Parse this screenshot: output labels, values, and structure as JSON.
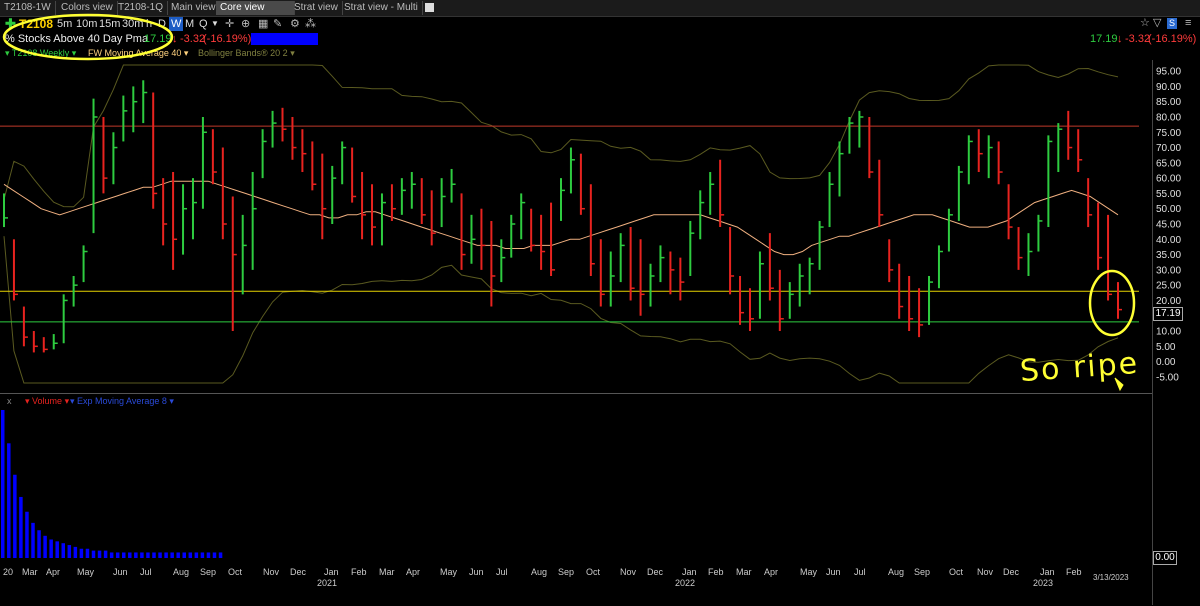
{
  "tabs": [
    {
      "label": "T2108-1W",
      "active": false
    },
    {
      "label": "Colors view",
      "active": false
    },
    {
      "label": "T2108-1Q",
      "active": false
    },
    {
      "label": "Main view",
      "active": false
    },
    {
      "label": "Core view",
      "active": true
    },
    {
      "label": "Strat view",
      "active": false
    },
    {
      "label": "Strat view - Multi",
      "active": false
    }
  ],
  "toolbar": {
    "symbol": "T2108",
    "intervals": [
      "5m",
      "10m",
      "15m",
      "30m",
      "h",
      "D",
      "W",
      "M",
      "Q"
    ],
    "selected_interval": "W"
  },
  "info": {
    "name": "% Stocks Above 40 Day Pma",
    "last": "17.19",
    "change": "-3.32",
    "change_pct": "(-16.19%)"
  },
  "legend": {
    "series": "T2108 Weekly",
    "ma": "FW Moving Average 40",
    "bb": "Bollinger Bands® 20 2"
  },
  "volume_legend": {
    "volume": "Volume",
    "ma": "Exp Moving Average 8"
  },
  "annotation": "So ripe",
  "chart_data": {
    "type": "bar",
    "ylim": [
      -7,
      97
    ],
    "yticks": [
      "95.00",
      "90.00",
      "85.00",
      "80.00",
      "75.00",
      "70.00",
      "65.00",
      "60.00",
      "55.00",
      "50.00",
      "45.00",
      "40.00",
      "35.00",
      "30.00",
      "25.00",
      "20.00",
      "15.00",
      "10.00",
      "5.00",
      "0.00",
      "-5.00"
    ],
    "last_label": "17.19",
    "volume_label": "0.00",
    "date_label": "3/13/2023",
    "x_labels": [
      "20",
      "Mar",
      "Apr",
      "May",
      "Jun",
      "Jul",
      "Aug",
      "Sep",
      "Oct",
      "Nov",
      "Dec",
      "Jan",
      "Feb",
      "Mar",
      "Apr",
      "May",
      "Jun",
      "Jul",
      "Aug",
      "Sep",
      "Oct",
      "Nov",
      "Dec",
      "Jan",
      "Feb",
      "Mar",
      "Apr",
      "May",
      "Jun",
      "Jul",
      "Aug",
      "Sep",
      "Oct",
      "Nov",
      "Dec",
      "Jan",
      "Feb"
    ],
    "year_labels": [
      "2021",
      "2022",
      "2023"
    ],
    "hlines": [
      {
        "value": 77,
        "color": "#c0392b"
      },
      {
        "value": 23,
        "color": "#e6d200"
      },
      {
        "value": 13,
        "color": "#2ecc40"
      }
    ],
    "colors": {
      "up": "#2ecc40",
      "down": "#e8231f",
      "ma": "#f0b080",
      "bb": "#5a5a20",
      "volume": "#0000ff"
    },
    "bars": [
      {
        "h": 55,
        "l": 44,
        "c": 47
      },
      {
        "h": 40,
        "l": 20,
        "c": 22
      },
      {
        "h": 18,
        "l": 5,
        "c": 8
      },
      {
        "h": 10,
        "l": 3,
        "c": 5
      },
      {
        "h": 8,
        "l": 3,
        "c": 4
      },
      {
        "h": 9,
        "l": 4,
        "c": 6
      },
      {
        "h": 22,
        "l": 6,
        "c": 20
      },
      {
        "h": 28,
        "l": 18,
        "c": 25
      },
      {
        "h": 38,
        "l": 26,
        "c": 36
      },
      {
        "h": 86,
        "l": 42,
        "c": 80
      },
      {
        "h": 80,
        "l": 55,
        "c": 60
      },
      {
        "h": 75,
        "l": 58,
        "c": 70
      },
      {
        "h": 87,
        "l": 72,
        "c": 82
      },
      {
        "h": 90,
        "l": 75,
        "c": 85
      },
      {
        "h": 92,
        "l": 78,
        "c": 88
      },
      {
        "h": 88,
        "l": 50,
        "c": 55
      },
      {
        "h": 60,
        "l": 38,
        "c": 45
      },
      {
        "h": 62,
        "l": 30,
        "c": 40
      },
      {
        "h": 58,
        "l": 35,
        "c": 50
      },
      {
        "h": 60,
        "l": 40,
        "c": 52
      },
      {
        "h": 80,
        "l": 50,
        "c": 75
      },
      {
        "h": 76,
        "l": 58,
        "c": 62
      },
      {
        "h": 70,
        "l": 40,
        "c": 45
      },
      {
        "h": 54,
        "l": 10,
        "c": 35
      },
      {
        "h": 48,
        "l": 22,
        "c": 38
      },
      {
        "h": 62,
        "l": 30,
        "c": 50
      },
      {
        "h": 76,
        "l": 60,
        "c": 72
      },
      {
        "h": 82,
        "l": 70,
        "c": 78
      },
      {
        "h": 83,
        "l": 72,
        "c": 76
      },
      {
        "h": 80,
        "l": 66,
        "c": 70
      },
      {
        "h": 76,
        "l": 62,
        "c": 68
      },
      {
        "h": 72,
        "l": 56,
        "c": 58
      },
      {
        "h": 68,
        "l": 40,
        "c": 50
      },
      {
        "h": 64,
        "l": 45,
        "c": 60
      },
      {
        "h": 72,
        "l": 58,
        "c": 70
      },
      {
        "h": 70,
        "l": 52,
        "c": 54
      },
      {
        "h": 62,
        "l": 40,
        "c": 48
      },
      {
        "h": 58,
        "l": 38,
        "c": 44
      },
      {
        "h": 55,
        "l": 38,
        "c": 52
      },
      {
        "h": 58,
        "l": 46,
        "c": 50
      },
      {
        "h": 60,
        "l": 48,
        "c": 56
      },
      {
        "h": 62,
        "l": 50,
        "c": 58
      },
      {
        "h": 60,
        "l": 45,
        "c": 48
      },
      {
        "h": 56,
        "l": 38,
        "c": 42
      },
      {
        "h": 60,
        "l": 44,
        "c": 54
      },
      {
        "h": 63,
        "l": 52,
        "c": 58
      },
      {
        "h": 55,
        "l": 30,
        "c": 35
      },
      {
        "h": 48,
        "l": 32,
        "c": 40
      },
      {
        "h": 50,
        "l": 30,
        "c": 38
      },
      {
        "h": 46,
        "l": 18,
        "c": 28
      },
      {
        "h": 40,
        "l": 26,
        "c": 34
      },
      {
        "h": 48,
        "l": 34,
        "c": 45
      },
      {
        "h": 55,
        "l": 40,
        "c": 52
      },
      {
        "h": 50,
        "l": 36,
        "c": 38
      },
      {
        "h": 48,
        "l": 30,
        "c": 36
      },
      {
        "h": 52,
        "l": 28,
        "c": 30
      },
      {
        "h": 60,
        "l": 46,
        "c": 56
      },
      {
        "h": 70,
        "l": 55,
        "c": 66
      },
      {
        "h": 68,
        "l": 48,
        "c": 50
      },
      {
        "h": 58,
        "l": 28,
        "c": 32
      },
      {
        "h": 40,
        "l": 18,
        "c": 22
      },
      {
        "h": 36,
        "l": 18,
        "c": 28
      },
      {
        "h": 42,
        "l": 26,
        "c": 38
      },
      {
        "h": 44,
        "l": 20,
        "c": 24
      },
      {
        "h": 40,
        "l": 15,
        "c": 22
      },
      {
        "h": 32,
        "l": 18,
        "c": 28
      },
      {
        "h": 38,
        "l": 26,
        "c": 34
      },
      {
        "h": 36,
        "l": 22,
        "c": 30
      },
      {
        "h": 34,
        "l": 20,
        "c": 26
      },
      {
        "h": 46,
        "l": 28,
        "c": 42
      },
      {
        "h": 56,
        "l": 40,
        "c": 52
      },
      {
        "h": 62,
        "l": 48,
        "c": 58
      },
      {
        "h": 66,
        "l": 44,
        "c": 48
      },
      {
        "h": 44,
        "l": 22,
        "c": 28
      },
      {
        "h": 28,
        "l": 12,
        "c": 16
      },
      {
        "h": 24,
        "l": 10,
        "c": 14
      },
      {
        "h": 36,
        "l": 14,
        "c": 32
      },
      {
        "h": 42,
        "l": 20,
        "c": 24
      },
      {
        "h": 30,
        "l": 10,
        "c": 14
      },
      {
        "h": 26,
        "l": 14,
        "c": 22
      },
      {
        "h": 32,
        "l": 18,
        "c": 28
      },
      {
        "h": 34,
        "l": 22,
        "c": 32
      },
      {
        "h": 46,
        "l": 30,
        "c": 44
      },
      {
        "h": 62,
        "l": 44,
        "c": 58
      },
      {
        "h": 72,
        "l": 54,
        "c": 68
      },
      {
        "h": 80,
        "l": 68,
        "c": 78
      },
      {
        "h": 82,
        "l": 70,
        "c": 80
      },
      {
        "h": 80,
        "l": 60,
        "c": 62
      },
      {
        "h": 66,
        "l": 44,
        "c": 48
      },
      {
        "h": 40,
        "l": 26,
        "c": 30
      },
      {
        "h": 32,
        "l": 14,
        "c": 18
      },
      {
        "h": 28,
        "l": 10,
        "c": 14
      },
      {
        "h": 24,
        "l": 8,
        "c": 12
      },
      {
        "h": 28,
        "l": 12,
        "c": 26
      },
      {
        "h": 38,
        "l": 24,
        "c": 36
      },
      {
        "h": 50,
        "l": 36,
        "c": 48
      },
      {
        "h": 64,
        "l": 46,
        "c": 62
      },
      {
        "h": 74,
        "l": 58,
        "c": 72
      },
      {
        "h": 76,
        "l": 62,
        "c": 68
      },
      {
        "h": 74,
        "l": 60,
        "c": 70
      },
      {
        "h": 72,
        "l": 58,
        "c": 62
      },
      {
        "h": 58,
        "l": 40,
        "c": 44
      },
      {
        "h": 44,
        "l": 30,
        "c": 34
      },
      {
        "h": 42,
        "l": 28,
        "c": 36
      },
      {
        "h": 48,
        "l": 36,
        "c": 46
      },
      {
        "h": 74,
        "l": 44,
        "c": 72
      },
      {
        "h": 78,
        "l": 62,
        "c": 76
      },
      {
        "h": 82,
        "l": 66,
        "c": 70
      },
      {
        "h": 76,
        "l": 62,
        "c": 66
      },
      {
        "h": 60,
        "l": 44,
        "c": 48
      },
      {
        "h": 52,
        "l": 30,
        "c": 34
      },
      {
        "h": 48,
        "l": 20,
        "c": 22
      },
      {
        "h": 26,
        "l": 14,
        "c": 17
      }
    ],
    "ma40": [
      58,
      56,
      54,
      52,
      50,
      49,
      48,
      49,
      50,
      51,
      52,
      53,
      54,
      55,
      56,
      57,
      57,
      58,
      59,
      59,
      59,
      59,
      59,
      58,
      57,
      56,
      55,
      54,
      53,
      52,
      51,
      50,
      49,
      48,
      48,
      47,
      47,
      48,
      48,
      49,
      49,
      48,
      47,
      46,
      45,
      44,
      43,
      42,
      41,
      40,
      39,
      38,
      38,
      38,
      37,
      37,
      37,
      38,
      38,
      38,
      39,
      40,
      40,
      41,
      42,
      43,
      44,
      45,
      46,
      47,
      48,
      48,
      48,
      48,
      48,
      48,
      47,
      46,
      45,
      44,
      42,
      40,
      38,
      36,
      35,
      35,
      36,
      38,
      39,
      40,
      41,
      41,
      42,
      43,
      44,
      45,
      46,
      47,
      48,
      48,
      48,
      47,
      46,
      45,
      44,
      44,
      44,
      45,
      46,
      48,
      50,
      52,
      53,
      54,
      55,
      56,
      55,
      54,
      52,
      50,
      48
    ],
    "volume": [
      80,
      62,
      45,
      33,
      25,
      19,
      15,
      12,
      10,
      9,
      8,
      7,
      6,
      5,
      5,
      4,
      4,
      4,
      3,
      3,
      3,
      3,
      3,
      3,
      3,
      3,
      3,
      3,
      3,
      3,
      3,
      3,
      3,
      3,
      3,
      3,
      3
    ]
  }
}
